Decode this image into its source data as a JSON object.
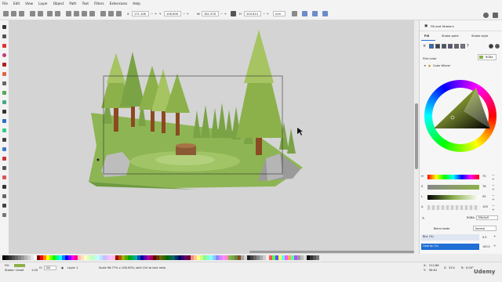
{
  "menu": [
    "File",
    "Edit",
    "View",
    "Layer",
    "Object",
    "Path",
    "Text",
    "Filters",
    "Extensions",
    "Help"
  ],
  "toolbar": {
    "x_label": "X",
    "x_value": "171.106",
    "y_label": "Y",
    "y_value": "106.006",
    "w_label": "W",
    "w_value": "161.378",
    "h_label": "H",
    "h_value": "100.614",
    "unit": "mm"
  },
  "panel": {
    "tab_title": "Fill and Stroke",
    "subtabs": [
      "Fill",
      "Stroke paint",
      "Stroke style"
    ],
    "flat_color": "Flat color",
    "rgba": "RGBA",
    "color_wheel": "Color Wheel",
    "sliders": [
      {
        "label": "H",
        "value": "75"
      },
      {
        "label": "S",
        "value": "76"
      },
      {
        "label": "L",
        "value": "55"
      },
      {
        "label": "A",
        "value": "100"
      }
    ],
    "rgba_label": "RGBA:",
    "rgba_value": "7f9b3aff",
    "blend_label": "Blend mode",
    "blend_value": "Normal",
    "blur_label": "Blur (%)",
    "blur_value": "0.0",
    "opacity_label": "Opacity (%)",
    "opacity_value": "100.0",
    "current_color": "#8cb14a"
  },
  "status": {
    "fill_label": "Fill:",
    "stroke_label": "Stroke:",
    "stroke_value": "Unset",
    "stroke_width": "1.00",
    "opacity_label": "O:",
    "opacity_value": "100",
    "layer": "Layer 1",
    "message": "Scale 96.77% x 106.00%; with Ctrl to lock ratio",
    "cursor_x_label": "X:",
    "cursor_x": "212.86",
    "cursor_y_label": "Y:",
    "cursor_y": "98.61",
    "zoom_label": "Z:",
    "zoom": "31%",
    "rotation_label": "R:",
    "rotation": "0.00°"
  },
  "watermark": "Udemy",
  "colors": {
    "sky": "#d4d4d4",
    "grass_light": "#8db553",
    "grass_mid": "#7aa346",
    "grass_dark": "#5f8a3a",
    "trunk": "#8b4a22",
    "rock": "#a5a5a5",
    "highlight": "#1f6fd4"
  }
}
